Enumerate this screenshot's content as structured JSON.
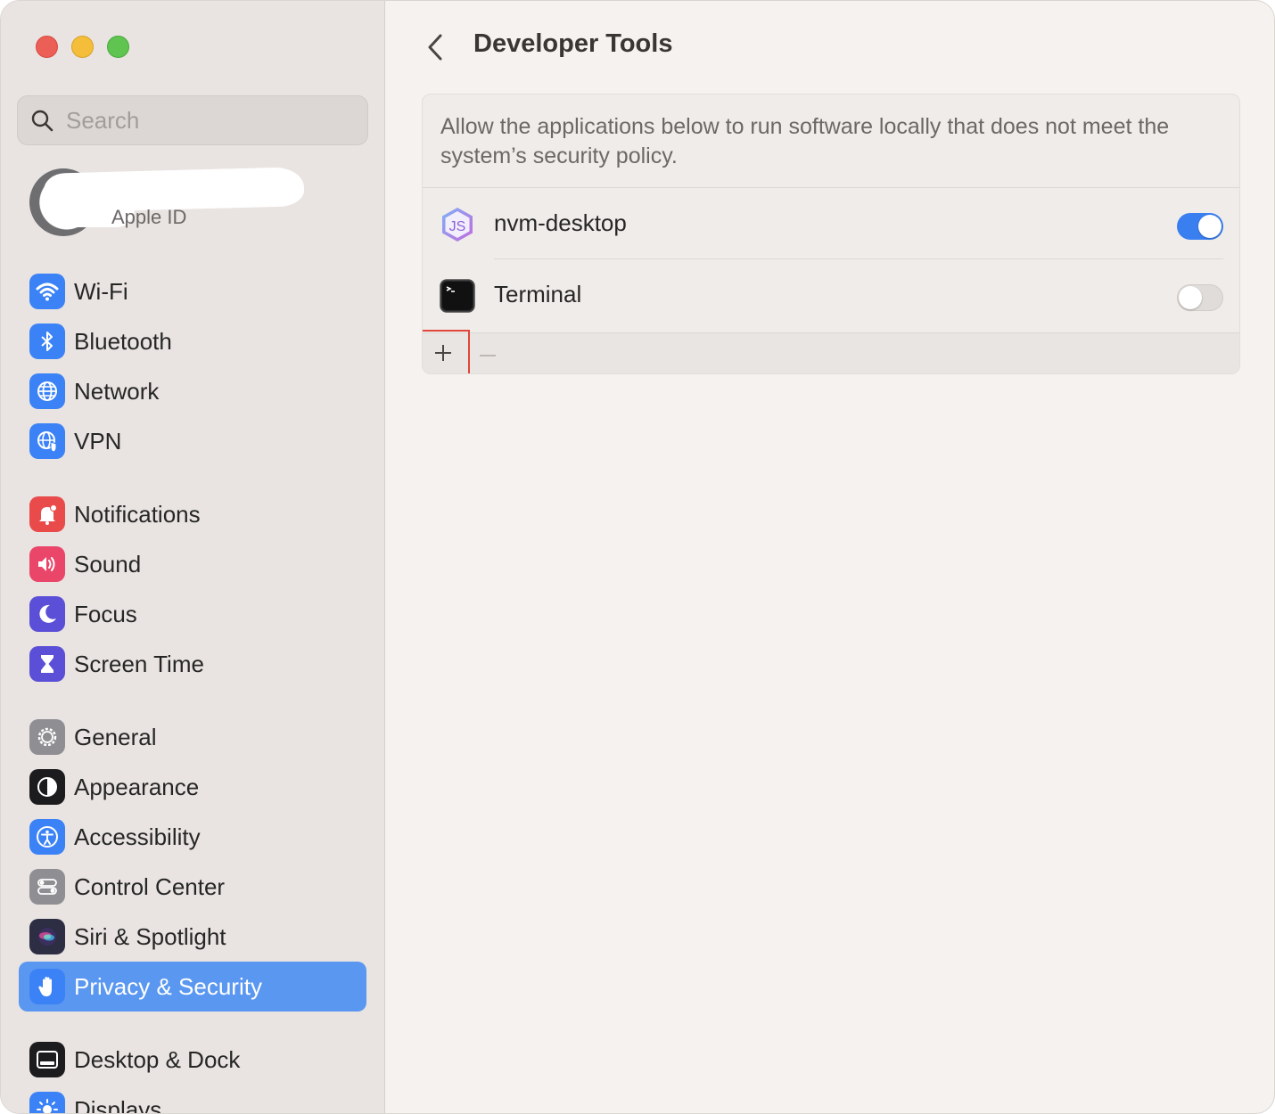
{
  "window": {
    "controls": [
      "close",
      "minimize",
      "maximize"
    ]
  },
  "sidebar": {
    "search": {
      "placeholder": "Search",
      "value": ""
    },
    "account": {
      "label": "Apple ID"
    },
    "groups": [
      [
        {
          "label": "Wi-Fi",
          "icon": "wifi-icon",
          "color": "#3b82f6"
        },
        {
          "label": "Bluetooth",
          "icon": "bluetooth-icon",
          "color": "#3b82f6"
        },
        {
          "label": "Network",
          "icon": "globe-icon",
          "color": "#3b82f6"
        },
        {
          "label": "VPN",
          "icon": "vpn-globe-icon",
          "color": "#3b82f6"
        }
      ],
      [
        {
          "label": "Notifications",
          "icon": "bell-icon",
          "color": "#e94b4b"
        },
        {
          "label": "Sound",
          "icon": "speaker-icon",
          "color": "#e9466a"
        },
        {
          "label": "Focus",
          "icon": "moon-icon",
          "color": "#5a4fd6"
        },
        {
          "label": "Screen Time",
          "icon": "hourglass-icon",
          "color": "#5a4fd6"
        }
      ],
      [
        {
          "label": "General",
          "icon": "gear-icon",
          "color": "#8e8e93"
        },
        {
          "label": "Appearance",
          "icon": "appearance-icon",
          "color": "#1c1c1e"
        },
        {
          "label": "Accessibility",
          "icon": "accessibility-icon",
          "color": "#3b82f6"
        },
        {
          "label": "Control Center",
          "icon": "switches-icon",
          "color": "#8e8e93"
        },
        {
          "label": "Siri & Spotlight",
          "icon": "siri-icon",
          "color": "#2d2d44"
        },
        {
          "label": "Privacy & Security",
          "icon": "hand-icon",
          "color": "#3b82f6",
          "active": true
        }
      ],
      [
        {
          "label": "Desktop & Dock",
          "icon": "dock-icon",
          "color": "#1c1c1e"
        },
        {
          "label": "Displays",
          "icon": "sun-icon",
          "color": "#3b82f6"
        }
      ]
    ]
  },
  "main": {
    "title": "Developer Tools",
    "description": "Allow the applications below to run software locally that does not meet the system’s security policy.",
    "apps": [
      {
        "name": "nvm-desktop",
        "icon": "js-hexagon-icon",
        "enabled": true
      },
      {
        "name": "Terminal",
        "icon": "terminal-icon",
        "enabled": false
      }
    ],
    "footer": {
      "add": "+",
      "remove": "−"
    }
  },
  "colors": {
    "accent": "#5a97f0",
    "toggle_on": "#3a7ff0",
    "highlight_box": "#e0453a"
  }
}
